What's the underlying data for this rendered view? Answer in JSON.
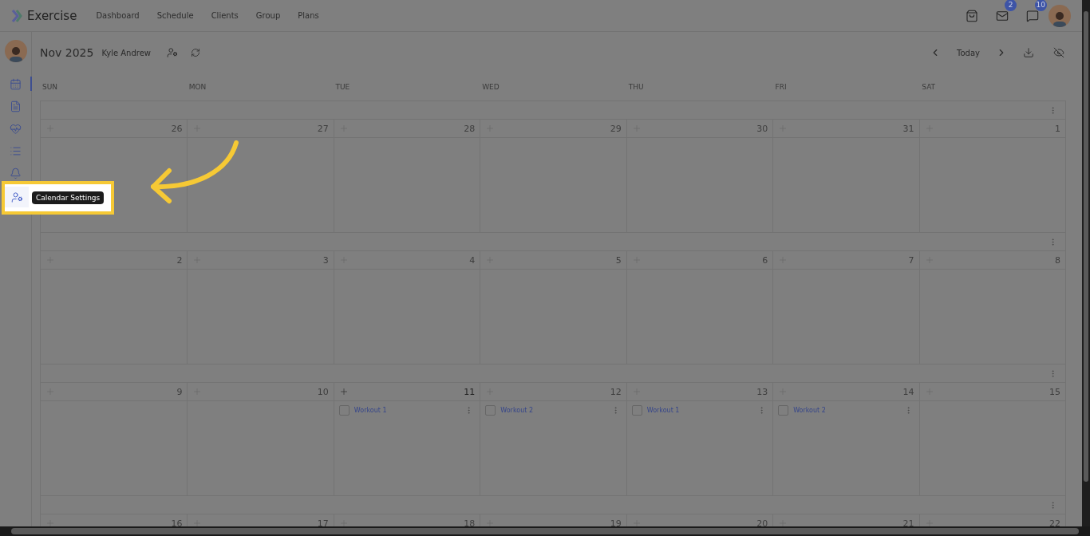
{
  "app": {
    "name": "Exercise"
  },
  "nav": [
    {
      "label": "Dashboard"
    },
    {
      "label": "Schedule"
    },
    {
      "label": "Clients"
    },
    {
      "label": "Group"
    },
    {
      "label": "Plans"
    }
  ],
  "notifications": [
    {
      "kind": "bag"
    },
    {
      "kind": "mail",
      "badge": "2"
    },
    {
      "kind": "chat",
      "badge": "10"
    }
  ],
  "sidebar": {
    "items": [
      {
        "kind": "calendar",
        "selected": true
      },
      {
        "kind": "document",
        "selected": false
      },
      {
        "kind": "health",
        "selected": false
      },
      {
        "kind": "list",
        "selected": false
      },
      {
        "kind": "bell",
        "selected": false
      },
      {
        "kind": "settings",
        "selected": false,
        "tooltip": "Calendar Settings"
      }
    ]
  },
  "header": {
    "month": "Nov 2025",
    "client": "Kyle Andrew",
    "today": "Today"
  },
  "weekdays": [
    "SUN",
    "MON",
    "TUE",
    "WED",
    "THU",
    "FRI",
    "SAT"
  ],
  "weeks": [
    {
      "days": [
        {
          "number": "26"
        },
        {
          "number": "27"
        },
        {
          "number": "28"
        },
        {
          "number": "29"
        },
        {
          "number": "30"
        },
        {
          "number": "31"
        },
        {
          "number": "1"
        }
      ]
    },
    {
      "days": [
        {
          "number": "2"
        },
        {
          "number": "3"
        },
        {
          "number": "4"
        },
        {
          "number": "5"
        },
        {
          "number": "6"
        },
        {
          "number": "7"
        },
        {
          "number": "8"
        }
      ]
    },
    {
      "days": [
        {
          "number": "9"
        },
        {
          "number": "10"
        },
        {
          "number": "11",
          "events": [
            {
              "title": "Workout 1",
              "checked": false
            }
          ]
        },
        {
          "number": "12",
          "events": [
            {
              "title": "Workout 2",
              "checked": false
            }
          ]
        },
        {
          "number": "13",
          "events": [
            {
              "title": "Workout 1",
              "checked": false
            }
          ]
        },
        {
          "number": "14",
          "events": [
            {
              "title": "Workout 2",
              "checked": false
            }
          ]
        },
        {
          "number": "15"
        }
      ]
    },
    {
      "days": [
        {
          "number": "16"
        },
        {
          "number": "17"
        },
        {
          "number": "18"
        },
        {
          "number": "19"
        },
        {
          "number": "20"
        },
        {
          "number": "21"
        },
        {
          "number": "22"
        }
      ]
    }
  ]
}
